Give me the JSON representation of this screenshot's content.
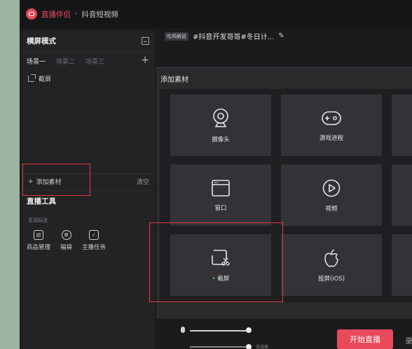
{
  "titlebar": {
    "app_name": "直播伴侣",
    "separator": " · ",
    "subtitle": "抖音短视频"
  },
  "sidebar": {
    "mode_title": "横屏模式",
    "tabs": [
      {
        "label": "场景一"
      },
      {
        "label": "场景二"
      },
      {
        "label": "场景三"
      }
    ],
    "tab_add": "+",
    "sources": [
      {
        "label": "截屏"
      }
    ],
    "add_source_label": "添加素材",
    "clear_label": "清空",
    "tools_title": "直播工具",
    "section_label": "互动玩法",
    "tools": [
      {
        "label": "商品管理"
      },
      {
        "label": "福袋"
      },
      {
        "label": "主播任务"
      }
    ]
  },
  "topic": {
    "badge": "吃鸡解说",
    "text": "#抖音开发哥哥#冬日计..."
  },
  "dialog": {
    "title": "添加素材",
    "tiles": [
      {
        "label": "摄像头",
        "icon": "camera-icon"
      },
      {
        "label": "游戏进程",
        "icon": "gamepad-icon"
      },
      {
        "label": "窗口",
        "icon": "window-icon"
      },
      {
        "label": "视频",
        "icon": "video-play-icon"
      },
      {
        "label": "截屏",
        "icon": "screenshot-icon",
        "selected": true
      },
      {
        "label": "投屏(iOS)",
        "icon": "apple-icon"
      }
    ]
  },
  "bottom": {
    "start_label": "开始直播",
    "record_label": "录",
    "slider2_label": "合成器"
  },
  "colors": {
    "accent": "#e8495b",
    "highlight": "#e0393e",
    "background": "#1b1b1d"
  }
}
